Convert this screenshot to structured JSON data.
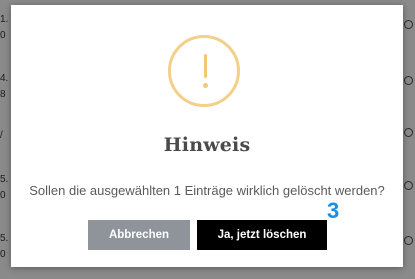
{
  "background": {
    "left_fragments": [
      "1.",
      "0",
      "4.",
      "8",
      "/",
      "5.",
      "0",
      "5.",
      "0"
    ],
    "right_fragments": [
      "?",
      "?",
      "?",
      "?",
      "?",
      "?"
    ]
  },
  "dialog": {
    "icon": "warning-exclamation-icon",
    "icon_color": "#f4cf8a",
    "title": "Hinweis",
    "message": "Sollen die ausgewählten 1 Einträge wirklich gelöscht werden?",
    "cancel_label": "Abbrechen",
    "confirm_label": "Ja, jetzt löschen"
  },
  "annotation": {
    "step_number": "3",
    "color": "#1a90e0"
  },
  "colors": {
    "overlay": "#7a7a7a",
    "cancel_button": "#8e949a",
    "confirm_button": "#000000"
  }
}
